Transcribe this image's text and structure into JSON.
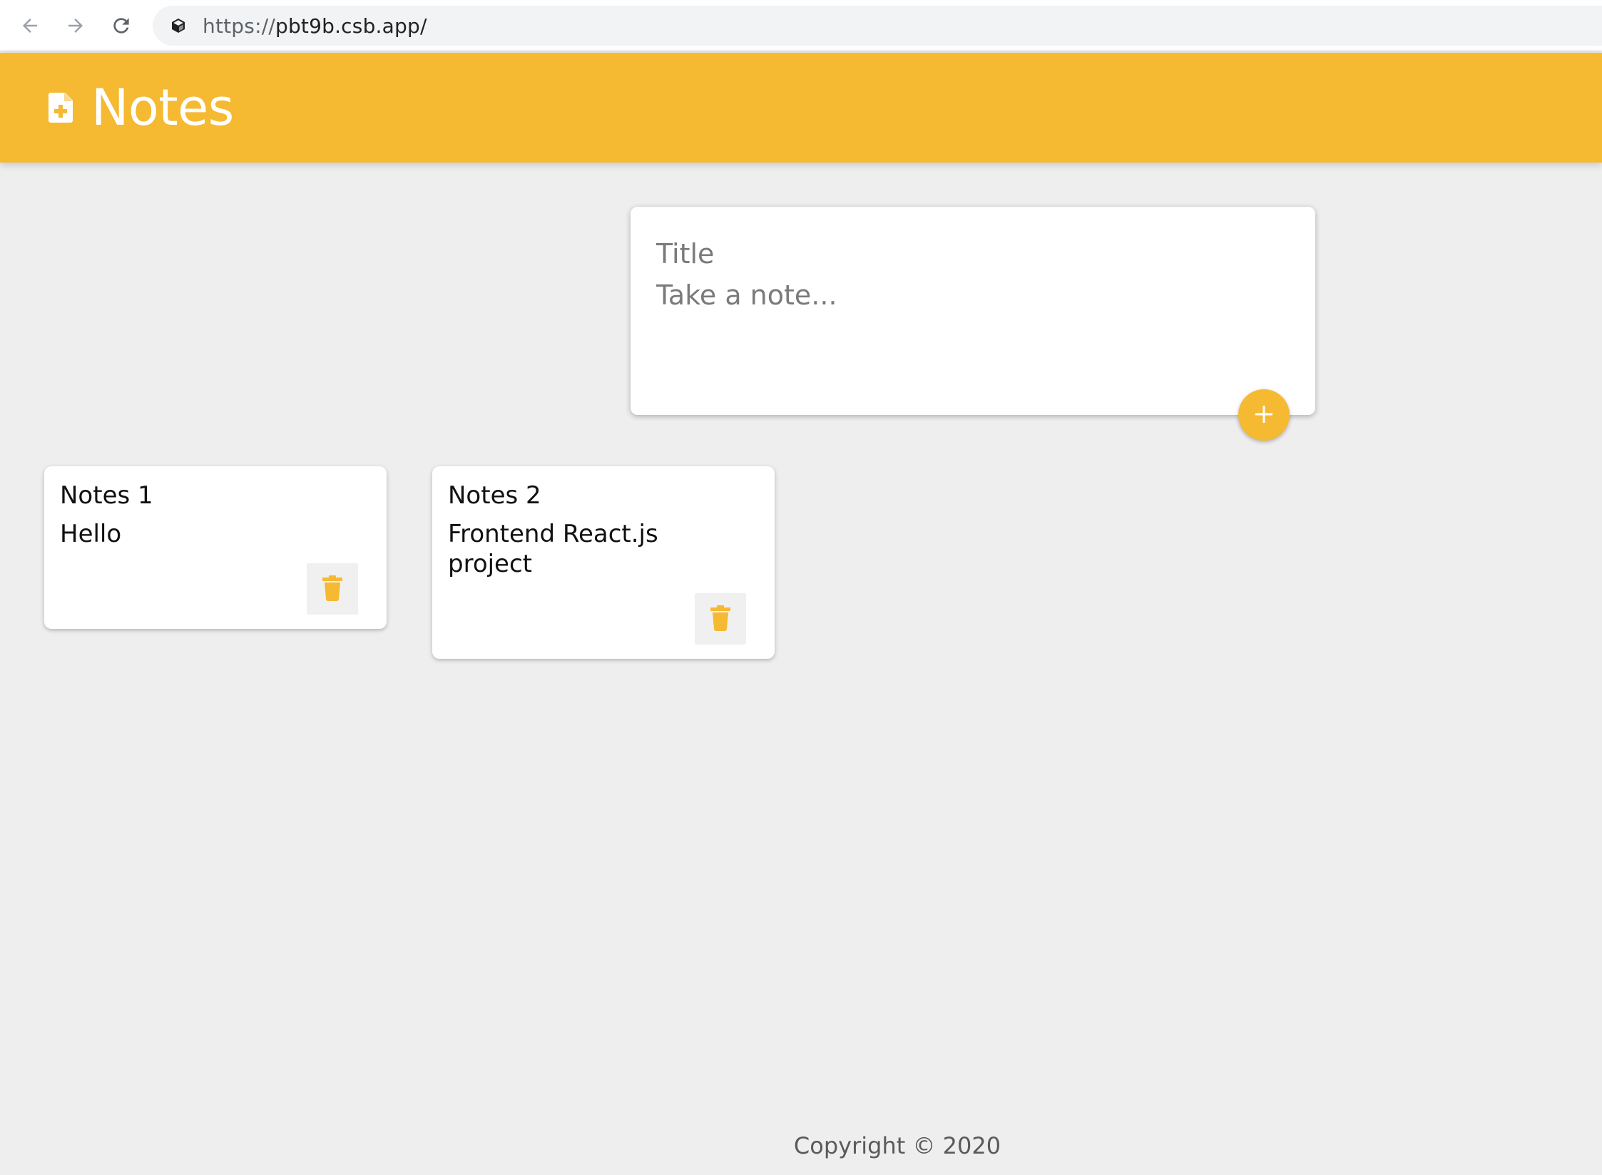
{
  "browser": {
    "url_scheme": "https://",
    "url_host": "pbt9b.csb.app/",
    "icons": {
      "back": "arrow-left-icon",
      "forward": "arrow-right-icon",
      "reload": "reload-icon",
      "site": "codesandbox-icon"
    }
  },
  "header": {
    "title": "Notes",
    "icon": "note-add-icon",
    "color": "#f5b932"
  },
  "create_area": {
    "title_placeholder": "Title",
    "content_placeholder": "Take a note...",
    "add_icon": "plus-icon"
  },
  "notes": [
    {
      "title": "Notes 1",
      "content": "Hello",
      "delete_icon": "trash-icon"
    },
    {
      "title": "Notes 2",
      "content": "Frontend React.js\nproject",
      "delete_icon": "trash-icon"
    }
  ],
  "footer": {
    "copyright": "Copyright © 2020"
  },
  "colors": {
    "accent": "#f5b932",
    "background": "#eeeeee"
  }
}
